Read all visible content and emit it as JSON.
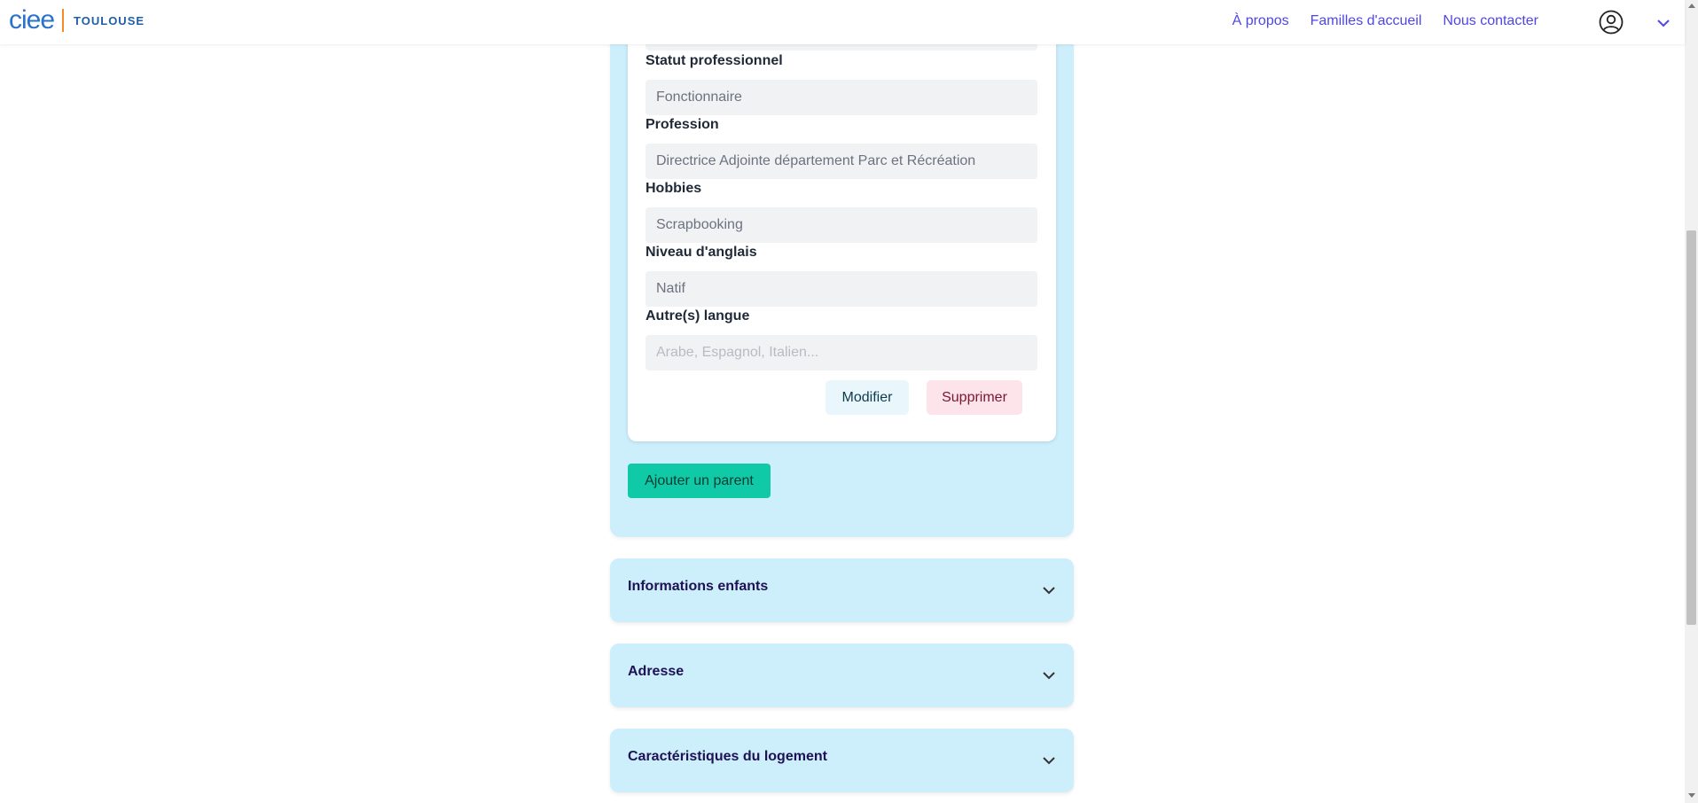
{
  "header": {
    "logo_text": "ciee",
    "city": "TOULOUSE",
    "nav": [
      "À propos",
      "Familles d'accueil",
      "Nous contacter"
    ],
    "user_icon": "user-circle-icon",
    "menu_icon": "chevron-down-icon"
  },
  "parent_form": {
    "fields": [
      {
        "label": "Statut professionnel",
        "value": "Fonctionnaire",
        "placeholder": ""
      },
      {
        "label": "Profession",
        "value": "Directrice Adjointe département Parc et Récréation",
        "placeholder": ""
      },
      {
        "label": "Hobbies",
        "value": "Scrapbooking",
        "placeholder": ""
      },
      {
        "label": "Niveau d'anglais",
        "value": "Natif",
        "placeholder": ""
      },
      {
        "label": "Autre(s) langue",
        "value": "",
        "placeholder": "Arabe, Espagnol, Italien..."
      }
    ],
    "edit_label": "Modifier",
    "delete_label": "Supprimer",
    "add_parent_label": "Ajouter un parent"
  },
  "sections": [
    {
      "title": "Informations enfants"
    },
    {
      "title": "Adresse"
    },
    {
      "title": "Caractéristiques du logement"
    }
  ],
  "colors": {
    "panel": "#cdeefb",
    "nav_link": "#4f46e5",
    "add_button": "#10c9a6",
    "delete_button": "#fde4ea",
    "edit_button": "#e9f7fd"
  }
}
